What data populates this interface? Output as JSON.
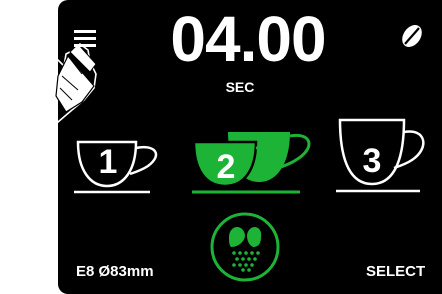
{
  "status": {
    "timer_value": "04.00",
    "timer_unit": "SEC"
  },
  "header": {
    "menu_icon": "menu-icon",
    "bean_icon": "coffee-bean-icon"
  },
  "cups": [
    {
      "label": "1",
      "selected": false
    },
    {
      "label": "2",
      "selected": true
    },
    {
      "label": "3",
      "selected": false
    }
  ],
  "grind": {
    "icon": "grind-icon"
  },
  "footer": {
    "error_info": "E8 Ø83mm",
    "select_label": "SELECT"
  },
  "colors": {
    "accent": "#1db336",
    "background": "#000000",
    "foreground": "#ffffff"
  }
}
